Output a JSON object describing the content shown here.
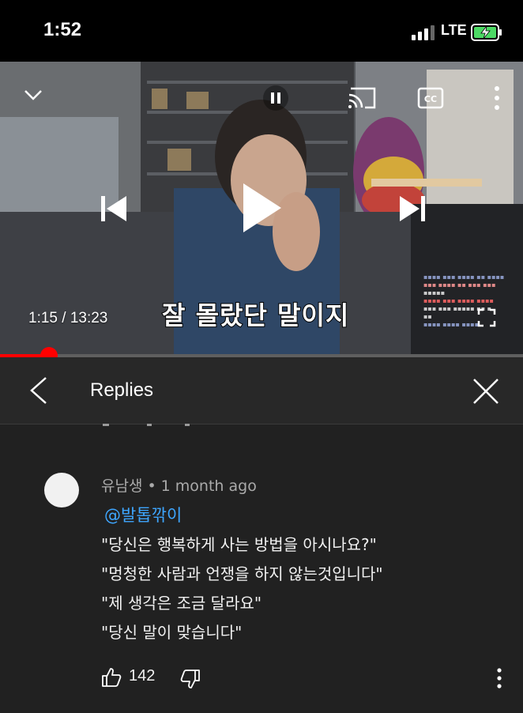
{
  "status_bar": {
    "time": "1:52",
    "network": "LTE"
  },
  "player": {
    "time_current": "1:15",
    "time_separator": "/",
    "time_total": "13:23",
    "subtitle": "잘 몰랐단 말이지",
    "progress_fraction": 0.094,
    "icons": [
      "chevron-down-icon",
      "pause-icon",
      "cast-icon",
      "cc-icon",
      "more-vert-icon",
      "previous-icon",
      "play-icon",
      "next-icon",
      "fullscreen-icon"
    ]
  },
  "replies_panel": {
    "title": "Replies",
    "comment": {
      "author": "유남생",
      "separator": "•",
      "time": "1 month ago",
      "mention": "@발톱깎이",
      "lines": [
        "\"당신은 행복하게 사는 방법을 아시나요?\"",
        "\"멍청한 사람과 언쟁을 하지 않는것입니다\"",
        "\"제 생각은 조금 달라요\"",
        "\"당신 말이 맞습니다\""
      ],
      "likes": "142"
    }
  },
  "colors": {
    "accent_red": "#ff0000",
    "mention_blue": "#3ea6ff",
    "panel_bg": "#212121"
  }
}
